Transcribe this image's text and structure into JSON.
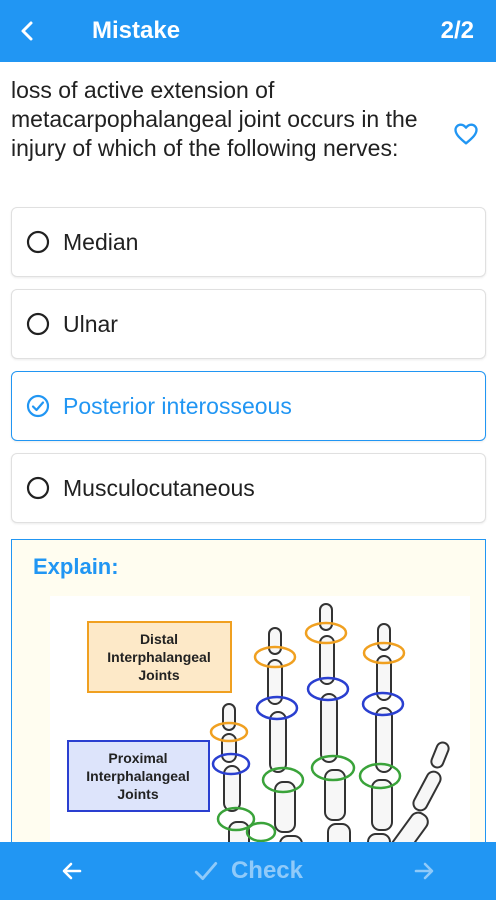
{
  "header": {
    "title": "Mistake",
    "counter": "2/2"
  },
  "question": {
    "text": "loss of active extension of metacarpophalangeal joint occurs in the injury of which of the following nerves:"
  },
  "options": [
    {
      "label": "Median",
      "selected": false
    },
    {
      "label": "Ulnar",
      "selected": false
    },
    {
      "label": "Posterior interosseous",
      "selected": true
    },
    {
      "label": "Musculocutaneous",
      "selected": false
    }
  ],
  "explain": {
    "title": "Explain:",
    "diagram": {
      "label_distal": [
        "Distal",
        "Interphalangeal",
        "Joints"
      ],
      "label_proximal": [
        "Proximal",
        "Interphalangeal",
        "Joints"
      ]
    }
  },
  "footer": {
    "check_label": "Check"
  },
  "colors": {
    "accent": "#2196f3",
    "disabled": "#90caf9",
    "orange": "#f0a020",
    "blue_ring": "#2a3fd0",
    "green_ring": "#3aa33a"
  },
  "icons": {
    "back": "arrow-left-icon",
    "favorite": "heart-outline-icon",
    "prev": "arrow-left-icon",
    "check": "check-icon",
    "next": "arrow-right-icon"
  }
}
